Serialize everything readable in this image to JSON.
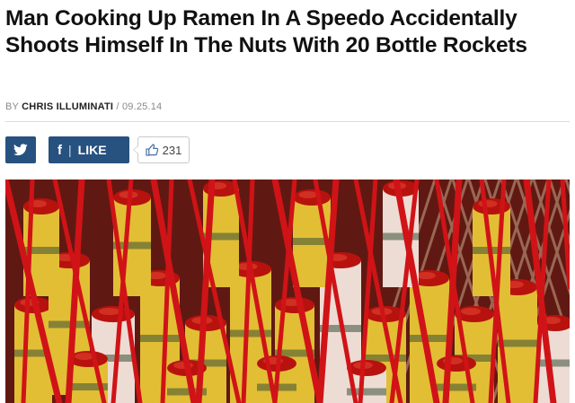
{
  "article": {
    "headline": "Man Cooking Up Ramen In A Speedo Accidentally Shoots Himself In The Nuts With 20 Bottle Rockets",
    "byline_prefix": "BY",
    "author": "CHRIS ILLUMINATI",
    "byline_separator": "/",
    "date": "09.25.14"
  },
  "share": {
    "twitter_icon": "twitter-bird-icon",
    "facebook_icon": "facebook-f-icon",
    "facebook_separator": "|",
    "like_label": "LIKE",
    "like_count_icon": "thumbs-up-icon",
    "like_count": "231"
  },
  "image": {
    "subject": "bundles of bottle rocket fireworks with red sticks and fuses",
    "colors": {
      "sticks": "#d3151a",
      "tubes": "#e6cf3a",
      "caps": "#b81410",
      "background": "#5a1c14"
    }
  },
  "theme": {
    "accent": "#27517f",
    "headline_color": "#111111",
    "meta_color": "#8a8a8a"
  }
}
